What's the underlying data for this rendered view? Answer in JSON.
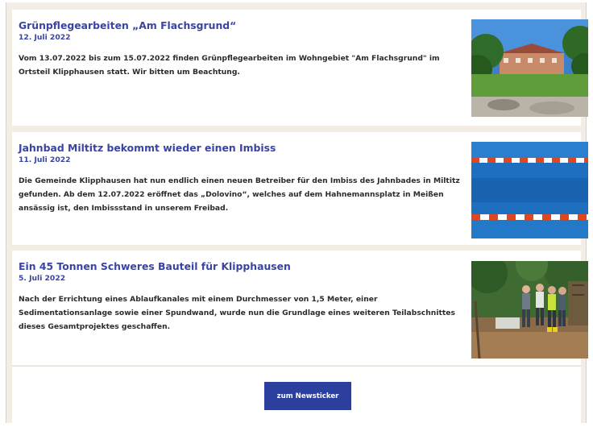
{
  "articles": [
    {
      "title": "Grünpflegearbeiten „Am Flachsgrund“",
      "date": "12. Juli 2022",
      "body": "Vom 13.07.2022 bis zum 15.07.2022 finden Grünpflegearbeiten im Wohngebiet \"Am Flachsgrund\" im Ortsteil Klipphausen statt. Wir bitten um Beachtung.",
      "image": "park-with-houses-photo"
    },
    {
      "title": "Jahnbad Miltitz bekommt wieder einen Imbiss",
      "date": "11. Juli 2022",
      "body": "Die Gemeinde Klipphausen hat nun endlich einen neuen Betreiber für den Imbiss des Jahnbades in Miltitz gefunden. Ab dem 12.07.2022 eröffnet das „Dolovino“, welches auf dem Hahnemannsplatz in Meißen ansässig ist, den Imbissstand in unserem Freibad.",
      "image": "swimming-pool-lane-lines-photo"
    },
    {
      "title": "Ein 45 Tonnen Schweres Bauteil für Klipphausen",
      "date": "5. Juli 2022",
      "body": "Nach der Errichtung eines Ablaufkanales mit einem Durchmesser von 1,5 Meter, einer Sedimentationsanlage sowie einer Spundwand, wurde nun die Grundlage eines weiteren Teilabschnittes dieses Gesamtprojektes geschaffen.",
      "image": "construction-site-people-photo"
    }
  ],
  "footer": {
    "button_label": "zum Newsticker"
  },
  "colors": {
    "accent": "#3a44a3",
    "button": "#2c3f9e",
    "background": "#f4ede6"
  }
}
